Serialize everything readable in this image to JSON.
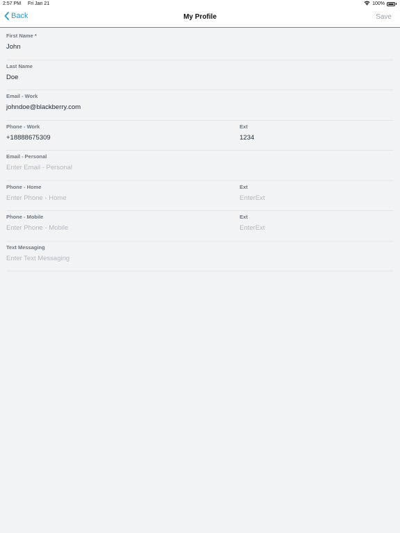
{
  "status_bar": {
    "time": "2:57 PM",
    "date": "Fri Jan 21",
    "battery": "100%",
    "battery_level": 1.0,
    "wifi_icon": "wifi-icon",
    "battery_icon": "battery-icon"
  },
  "nav": {
    "back_label": "Back",
    "back_icon": "chevron-left-icon",
    "title": "My Profile",
    "save_label": "Save"
  },
  "colors": {
    "accent": "#2c9ccd",
    "background": "#f2f3f5",
    "label": "#6e7880",
    "placeholder": "#b3b9be",
    "disabled": "#9aa2a8"
  },
  "form": {
    "first_name": {
      "label": "First Name *",
      "value": "John"
    },
    "last_name": {
      "label": "Last Name",
      "value": "Doe"
    },
    "email_work": {
      "label": "Email - Work",
      "value": "johndoe@blackberry.com"
    },
    "phone_work": {
      "label": "Phone - Work",
      "value": "+18888675309"
    },
    "phone_work_ext": {
      "label": "Ext",
      "value": "1234"
    },
    "email_personal": {
      "label": "Email - Personal",
      "placeholder": "Enter Email - Personal"
    },
    "phone_home": {
      "label": "Phone - Home",
      "placeholder": "Enter Phone - Home"
    },
    "phone_home_ext": {
      "label": "Ext",
      "placeholder": "EnterExt"
    },
    "phone_mobile": {
      "label": "Phone - Mobile",
      "placeholder": "Enter Phone - Mobile"
    },
    "phone_mobile_ext": {
      "label": "Ext",
      "placeholder": "EnterExt"
    },
    "text_messaging": {
      "label": "Text Messaging",
      "placeholder": "Enter Text Messaging"
    }
  }
}
